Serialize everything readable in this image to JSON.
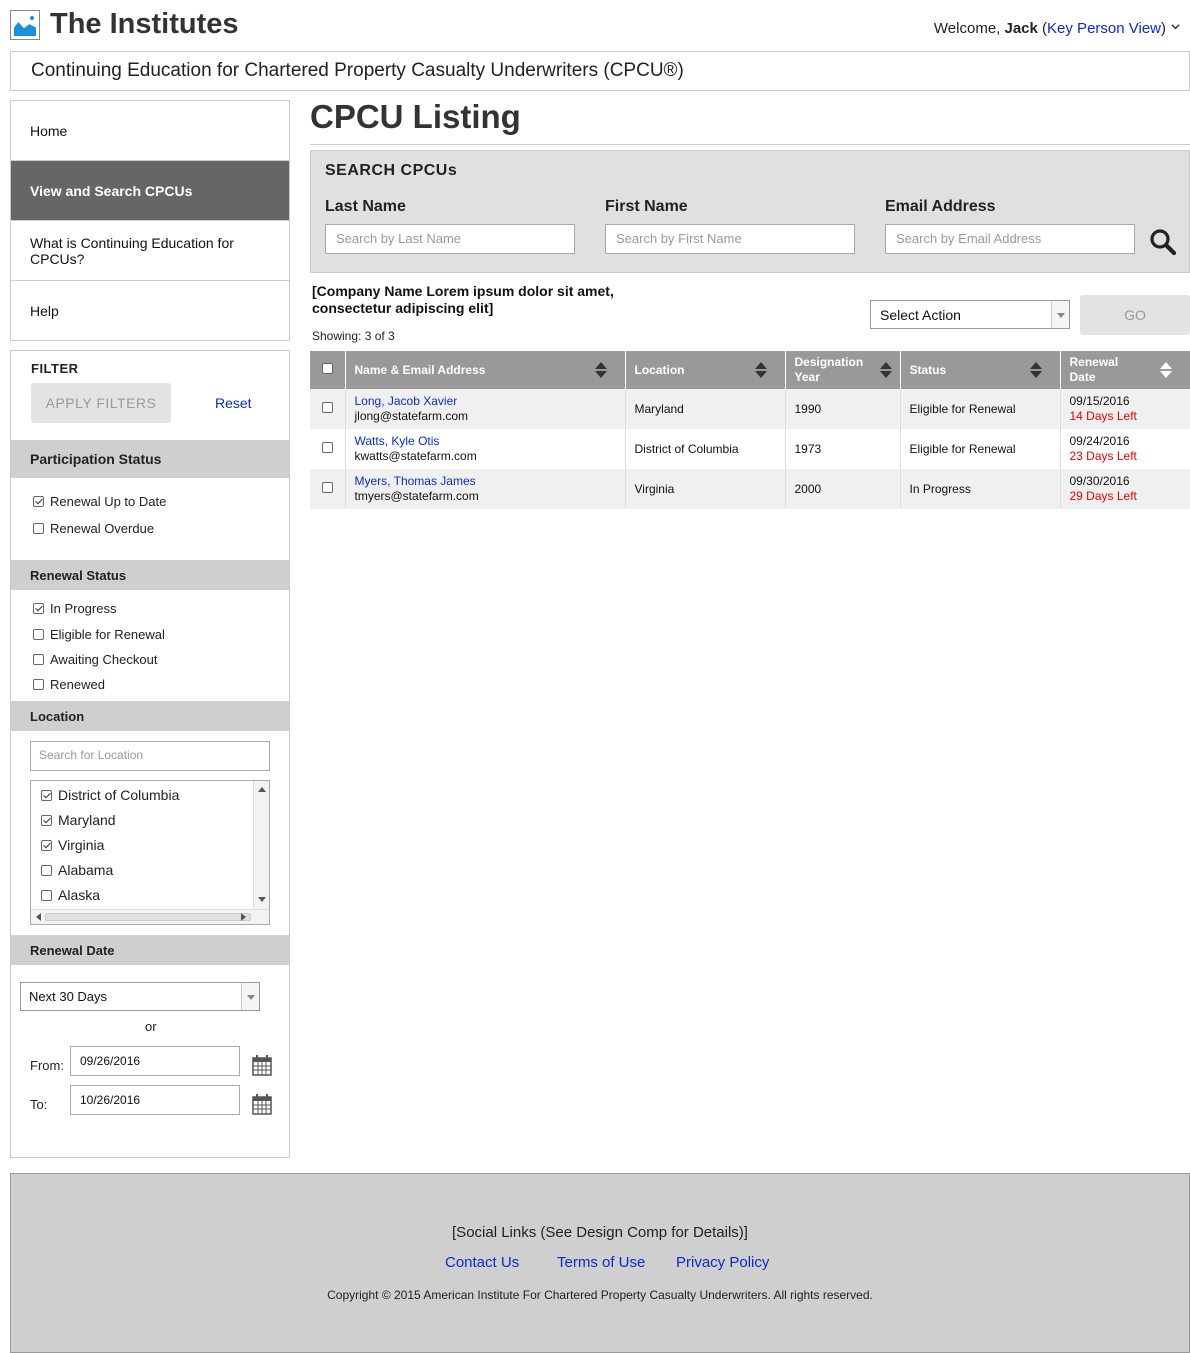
{
  "header": {
    "site_title": "The Institutes",
    "welcome_prefix": "Welcome, ",
    "user_name": "Jack",
    "paren_open": "(",
    "key_person_view": "Key Person View",
    "paren_close": ")",
    "subtitle": "Continuing Education for Chartered Property Casualty Underwriters (CPCU®)"
  },
  "nav": {
    "items": [
      {
        "label": "Home"
      },
      {
        "label": "View and Search CPCUs",
        "active": true
      },
      {
        "label": "What is Continuing Education for CPCUs?"
      },
      {
        "label": "Help"
      }
    ]
  },
  "filter": {
    "title": "FILTER",
    "apply_label": "APPLY FILTERS",
    "reset_label": "Reset",
    "participation": {
      "heading": "Participation Status",
      "options": [
        {
          "label": "Renewal Up to Date",
          "checked": true
        },
        {
          "label": "Renewal Overdue",
          "checked": false
        }
      ]
    },
    "renewal_status": {
      "heading": "Renewal Status",
      "options": [
        {
          "label": "In Progress",
          "checked": true
        },
        {
          "label": "Eligible for Renewal",
          "checked": false
        },
        {
          "label": "Awaiting Checkout",
          "checked": false
        },
        {
          "label": "Renewed",
          "checked": false
        }
      ]
    },
    "location": {
      "heading": "Location",
      "search_placeholder": "Search for Location",
      "options": [
        {
          "label": "District of Columbia",
          "checked": true
        },
        {
          "label": "Maryland",
          "checked": true
        },
        {
          "label": "Virginia",
          "checked": true
        },
        {
          "label": "Alabama",
          "checked": false
        },
        {
          "label": "Alaska",
          "checked": false
        }
      ]
    },
    "renewal_date": {
      "heading": "Renewal Date",
      "range_value": "Next 30 Days",
      "or_label": "or",
      "from_label": "From:",
      "from_value": "09/26/2016",
      "to_label": "To:",
      "to_value": "10/26/2016"
    }
  },
  "main": {
    "page_title": "CPCU Listing",
    "search": {
      "title": "SEARCH CPCUs",
      "last_name_label": "Last Name",
      "last_name_placeholder": "Search by Last Name",
      "first_name_label": "First Name",
      "first_name_placeholder": "Search by First Name",
      "email_label": "Email Address",
      "email_placeholder": "Search by Email Address"
    },
    "company_text": "[Company Name Lorem ipsum dolor sit amet, consectetur adipiscing elit]",
    "showing": "Showing: 3 of 3",
    "action_select": "Select Action",
    "go_label": "GO",
    "table": {
      "headers": [
        "Name & Email Address",
        "Location",
        "Designation Year",
        "Status",
        "Renewal Date"
      ],
      "rows": [
        {
          "name": "Long, Jacob Xavier",
          "email": "jlong@statefarm.com",
          "location": "Maryland",
          "year": "1990",
          "status": "Eligible for Renewal",
          "date": "09/15/2016",
          "days_left": "14 Days Left"
        },
        {
          "name": "Watts, Kyle Otis",
          "email": "kwatts@statefarm.com",
          "location": "District of Columbia",
          "year": "1973",
          "status": "Eligible for Renewal",
          "date": "09/24/2016",
          "days_left": "23 Days Left"
        },
        {
          "name": "Myers, Thomas James",
          "email": "tmyers@statefarm.com",
          "location": "Virginia",
          "year": "2000",
          "status": "In Progress",
          "date": "09/30/2016",
          "days_left": "29 Days Left"
        }
      ]
    }
  },
  "footer": {
    "social": "[Social Links (See Design Comp for Details)]",
    "links": [
      "Contact Us",
      "Terms of Use",
      "Privacy Policy"
    ],
    "copyright": "Copyright © 2015 American Institute For Chartered Property Casualty Underwriters. All rights reserved."
  },
  "colors": {
    "link": "#0a2ad0",
    "days_left": "#ee0000",
    "brand_blue": "#1a90d8",
    "nav_active": "#666666"
  }
}
